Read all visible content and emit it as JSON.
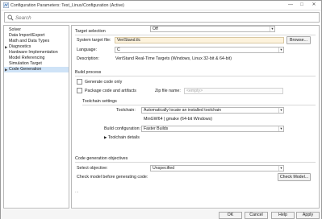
{
  "window": {
    "title": "Configuration Parameters: Test_Linux/Configuration (Active)",
    "min_glyph": "—",
    "max_glyph": "□",
    "close_glyph": "✕"
  },
  "search": {
    "placeholder": "Search"
  },
  "sidebar": {
    "items": [
      {
        "label": "Solver",
        "expandable": false,
        "selected": false
      },
      {
        "label": "Data Import/Export",
        "expandable": false,
        "selected": false
      },
      {
        "label": "Math and Data Types",
        "expandable": false,
        "selected": false
      },
      {
        "label": "Diagnostics",
        "expandable": true,
        "selected": false
      },
      {
        "label": "Hardware Implementation",
        "expandable": false,
        "selected": false
      },
      {
        "label": "Model Referencing",
        "expandable": false,
        "selected": false
      },
      {
        "label": "Simulation Target",
        "expandable": false,
        "selected": false
      },
      {
        "label": "Code Generation",
        "expandable": true,
        "selected": true
      }
    ]
  },
  "target_selection": {
    "heading": "Target selection",
    "system_target_label": "System target file:",
    "system_target_value": "VeriStand.tlc",
    "browse_label": "Browse...",
    "language_label": "Language:",
    "language_value": "C",
    "description_label": "Description:",
    "description_value": "VeriStand Real-Time Targets (Windows, Linux 32-bit & 64-bit)"
  },
  "build_process": {
    "heading": "Build process",
    "generate_code_only_label": "Generate code only",
    "package_label": "Package code and artifacts",
    "zip_label": "Zip file name:",
    "zip_placeholder": "<empty>",
    "toolchain_settings_heading": "Toolchain settings",
    "toolchain_label": "Toolchain:",
    "toolchain_value": "Automatically locate an installed toolchain",
    "toolchain_detected": "MinGW64 | gmake (64-bit Windows)",
    "build_config_label": "Build configuration:",
    "build_config_value": "Faster Builds",
    "toolchain_details_label": "Toolchain details"
  },
  "objectives": {
    "heading": "Code generation objectives",
    "select_objective_label": "Select objective:",
    "select_objective_value": "Unspecified",
    "check_model_label": "Check model before generating code:",
    "check_model_value": "Off",
    "check_model_button": "Check Model...",
    "more": "..."
  },
  "footer": {
    "ok": "OK",
    "cancel": "Cancel",
    "help": "Help",
    "apply": "Apply"
  },
  "colors": {
    "selection": "#cfe3f7",
    "highlight_field": "#fdf3dd",
    "accent_icon": "#2f6db5"
  }
}
